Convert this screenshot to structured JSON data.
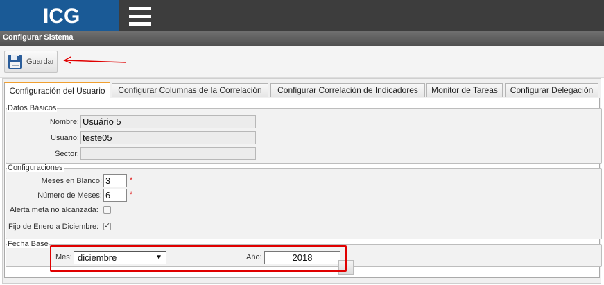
{
  "header": {
    "logo": "ICG",
    "menu_icon": "hamburger-menu-icon"
  },
  "title_bar": {
    "title": "Configurar Sistema"
  },
  "toolbar": {
    "save_label": "Guardar",
    "save_icon": "floppy-disk-icon"
  },
  "tabs": [
    {
      "label": "Configuración del Usuario",
      "active": true
    },
    {
      "label": "Configurar Columnas de la Correlación",
      "active": false
    },
    {
      "label": "Configurar Correlación de Indicadores",
      "active": false
    },
    {
      "label": "Monitor de Tareas",
      "active": false
    },
    {
      "label": "Configurar Delegación",
      "active": false
    }
  ],
  "datos_basicos": {
    "legend": "Datos Básicos",
    "nombre_label": "Nombre:",
    "nombre_value": "Usuário 5",
    "usuario_label": "Usuario:",
    "usuario_value": "teste05",
    "sector_label": "Sector:",
    "sector_value": ""
  },
  "configuraciones": {
    "legend": "Configuraciones",
    "meses_blanco_label": "Meses en Blanco:",
    "meses_blanco_value": "3",
    "numero_meses_label": "Número de Meses:",
    "numero_meses_value": "6",
    "required_mark": "*",
    "alerta_label": "Alerta meta no alcanzada:",
    "alerta_checked": false,
    "fijo_label": "Fijo de Enero a Diciembre:",
    "fijo_checked": true
  },
  "fecha_base": {
    "legend": "Fecha Base",
    "mes_label": "Mes:",
    "mes_value": "diciembre",
    "anio_label": "Año:",
    "anio_value": "2018"
  },
  "colors": {
    "logo_bg": "#1a5a96",
    "topbar_bg": "#3d3d3d",
    "annotation_red": "#e00000",
    "active_tab_accent": "#f0a030"
  }
}
